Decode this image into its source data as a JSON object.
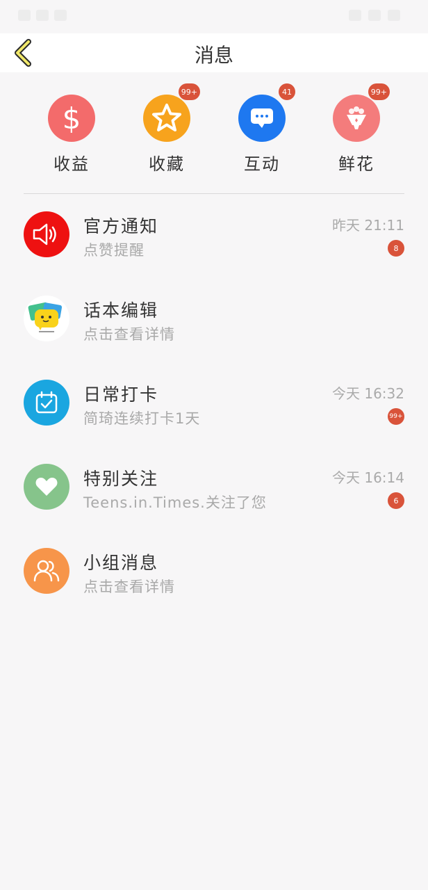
{
  "header": {
    "title": "消息"
  },
  "quick_actions": [
    {
      "label": "收益",
      "icon": "dollar-icon",
      "color": "#f36b6b",
      "badge": ""
    },
    {
      "label": "收藏",
      "icon": "star-icon",
      "color": "#f7a31d",
      "badge": "99+"
    },
    {
      "label": "互动",
      "icon": "chat-bubble-icon",
      "color": "#1e78f0",
      "badge": "41"
    },
    {
      "label": "鲜花",
      "icon": "flower-bouquet-icon",
      "color": "#f47c7c",
      "badge": "99+"
    }
  ],
  "messages": [
    {
      "title": "官方通知",
      "subtitle": "点赞提醒",
      "time": "昨天 21:11",
      "badge": "8",
      "icon": "speaker-icon",
      "color": "#ee1111"
    },
    {
      "title": "话本编辑",
      "subtitle": "点击查看详情",
      "time": "",
      "badge": "",
      "icon": "editor-avatar-icon",
      "color": "#ffffff"
    },
    {
      "title": "日常打卡",
      "subtitle": "简琦连续打卡1天",
      "time": "今天 16:32",
      "badge": "99+",
      "icon": "calendar-check-icon",
      "color": "#1aa6e0"
    },
    {
      "title": "特别关注",
      "subtitle": "Teens.in.Times.关注了您",
      "time": "今天 16:14",
      "badge": "6",
      "icon": "heart-icon",
      "color": "#86c48b"
    },
    {
      "title": "小组消息",
      "subtitle": "点击查看详情",
      "time": "",
      "badge": "",
      "icon": "group-icon",
      "color": "#f7954a"
    }
  ],
  "colors": {
    "badge": "#d9533a",
    "background": "#f7f6f7",
    "back_arrow": "#f1e86a"
  }
}
